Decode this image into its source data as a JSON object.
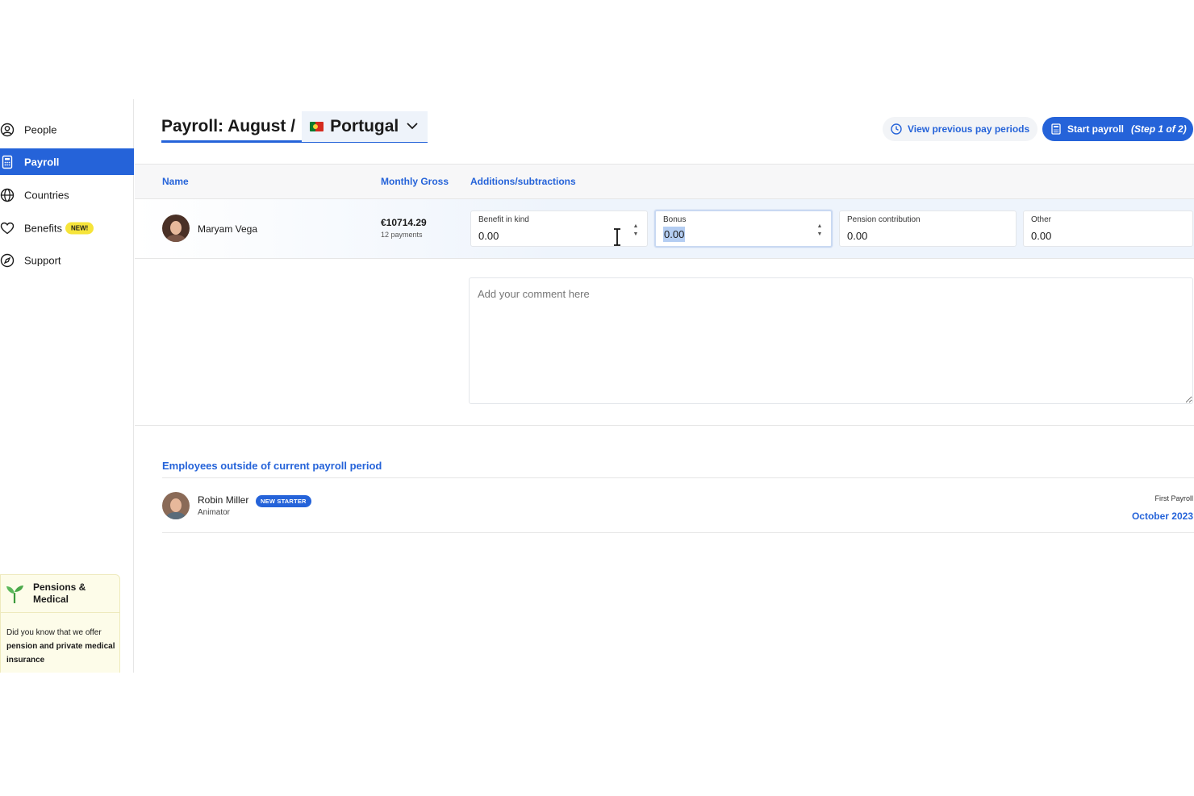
{
  "sidebar": {
    "items": [
      {
        "label": "People",
        "icon": "user-circle-icon"
      },
      {
        "label": "Payroll",
        "icon": "calculator-icon",
        "active": true
      },
      {
        "label": "Countries",
        "icon": "globe-icon"
      },
      {
        "label": "Benefits",
        "icon": "heart-icon",
        "badge": "NEW!"
      },
      {
        "label": "Support",
        "icon": "compass-icon"
      }
    ],
    "promo": {
      "title": "Pensions & Medical",
      "body_prefix": "Did you know that we offer ",
      "body_bold": "pension and private medical insurance",
      "icon": "sprout-icon"
    }
  },
  "header": {
    "title": "Payroll: August /",
    "country": "Portugal",
    "country_flag": "portugal-flag",
    "view_previous_label": "View previous pay periods",
    "start_payroll_label": "Start payroll",
    "start_payroll_step": "(Step 1 of 2)"
  },
  "table": {
    "columns": [
      "Name",
      "Monthly Gross",
      "Additions/subtractions"
    ],
    "rows": [
      {
        "name": "Maryam Vega",
        "gross": "€10714.29",
        "payments": "12 payments",
        "fields": [
          {
            "label": "Benefit in kind",
            "value": "0.00"
          },
          {
            "label": "Bonus",
            "value": "0.00",
            "focused": true
          },
          {
            "label": "Pension contribution",
            "value": "0.00"
          },
          {
            "label": "Other",
            "value": "0.00"
          }
        ]
      }
    ],
    "comment_placeholder": "Add your comment here"
  },
  "outside": {
    "title": "Employees outside of current payroll period",
    "employees": [
      {
        "name": "Robin Miller",
        "badge": "NEW STARTER",
        "role": "Animator",
        "first_payroll_label": "First Payroll",
        "first_payroll_value": "October 2023"
      }
    ]
  },
  "colors": {
    "accent": "#2563d9",
    "badge_new": "#f6e43a",
    "promo_bg": "#fdfce9"
  }
}
